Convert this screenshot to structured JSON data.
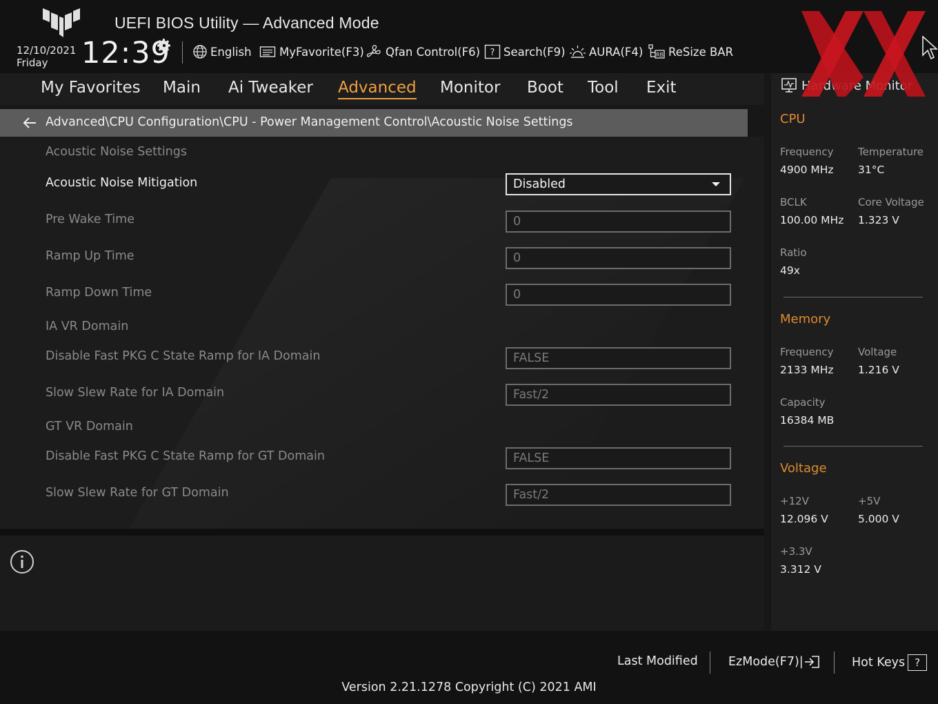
{
  "header": {
    "title": "UEFI BIOS Utility — Advanced Mode",
    "date": "12/10/2021",
    "day": "Friday",
    "time": "12:39",
    "toolbar": {
      "language": "English",
      "my_favorite": "MyFavorite(F3)",
      "qfan": "Qfan Control(F6)",
      "search": "Search(F9)",
      "aura": "AURA(F4)",
      "resize_bar": "ReSize BAR"
    }
  },
  "nav": {
    "tabs": [
      "My Favorites",
      "Main",
      "Ai Tweaker",
      "Advanced",
      "Monitor",
      "Boot",
      "Tool",
      "Exit"
    ],
    "active": "Advanced"
  },
  "breadcrumb": "Advanced\\CPU Configuration\\CPU - Power Management Control\\Acoustic Noise Settings",
  "settings": {
    "heading": "Acoustic Noise Settings",
    "acoustic_noise_mitigation": {
      "label": "Acoustic Noise Mitigation",
      "value": "Disabled"
    },
    "pre_wake_time": {
      "label": "Pre Wake Time",
      "value": "0"
    },
    "ramp_up_time": {
      "label": "Ramp Up Time",
      "value": "0"
    },
    "ramp_down_time": {
      "label": "Ramp Down Time",
      "value": "0"
    },
    "ia_vr_domain": "IA VR Domain",
    "disable_fast_pkg_ia": {
      "label": "Disable Fast PKG C State Ramp for IA Domain",
      "value": "FALSE"
    },
    "slow_slew_ia": {
      "label": "Slow Slew Rate for IA Domain",
      "value": "Fast/2"
    },
    "gt_vr_domain": "GT VR Domain",
    "disable_fast_pkg_gt": {
      "label": "Disable Fast PKG C State Ramp for GT Domain",
      "value": "FALSE"
    },
    "slow_slew_gt": {
      "label": "Slow Slew Rate for GT Domain",
      "value": "Fast/2"
    }
  },
  "hardware_monitor": {
    "title": "Hardware Monitor",
    "cpu": {
      "section": "CPU",
      "frequency_label": "Frequency",
      "frequency": "4900 MHz",
      "temperature_label": "Temperature",
      "temperature": "31°C",
      "bclk_label": "BCLK",
      "bclk": "100.00 MHz",
      "core_voltage_label": "Core Voltage",
      "core_voltage": "1.323 V",
      "ratio_label": "Ratio",
      "ratio": "49x"
    },
    "memory": {
      "section": "Memory",
      "frequency_label": "Frequency",
      "frequency": "2133 MHz",
      "voltage_label": "Voltage",
      "voltage": "1.216 V",
      "capacity_label": "Capacity",
      "capacity": "16384 MB"
    },
    "voltage": {
      "section": "Voltage",
      "v12_label": "+12V",
      "v12": "12.096 V",
      "v5_label": "+5V",
      "v5": "5.000 V",
      "v33_label": "+3.3V",
      "v33": "3.312 V"
    }
  },
  "footer": {
    "last_modified": "Last Modified",
    "ezmode": "EzMode(F7)|",
    "hot_keys": "Hot Keys",
    "hot_keys_glyph": "?",
    "version": "Version 2.21.1278 Copyright (C) 2021 AMI"
  },
  "colors": {
    "accent": "#f0a040",
    "section_orange": "#e08a2e",
    "watermark_red": "#c0141c"
  }
}
